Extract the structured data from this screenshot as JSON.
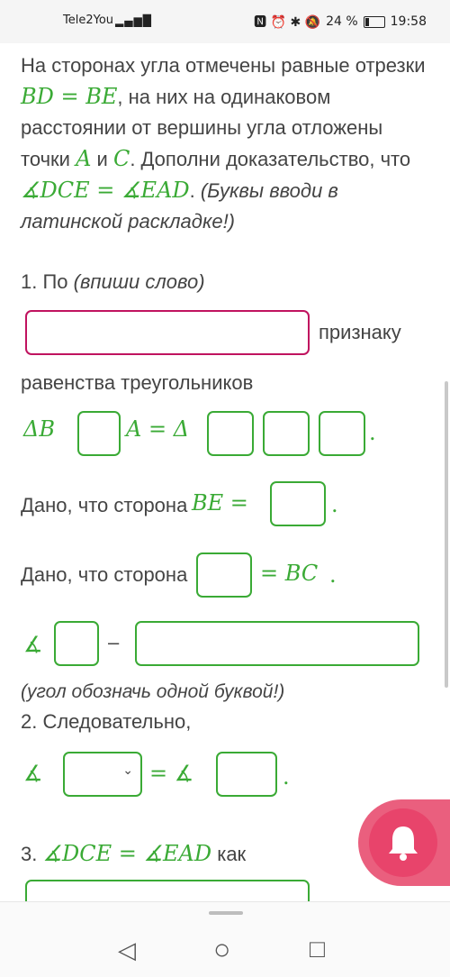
{
  "status_bar": {
    "carrier": "Tele2You",
    "signal": "▂▄▆█",
    "icons": "🅽 ⏰ ✱ 🔕",
    "battery": "24 %",
    "time": "19:58"
  },
  "task": {
    "intro_1": "На сторонах угла отмечены равные отрезки ",
    "eq_1": "BD = BE",
    "intro_2": ", на них на одинаковом расстоянии от вершины угла отложены точки ",
    "point_a": "A",
    "and": " и ",
    "point_c": "C",
    "intro_3": ". Дополни доказательство, что ",
    "angle_eq": "∡DCE = ∡EAD",
    "intro_4": ". ",
    "note": "(Буквы вводи в латинской раскладке!)"
  },
  "step1": {
    "label": "1. По ",
    "hint": "(впиши слово)",
    "after_input": "признаку",
    "line2": "равенства треугольников",
    "tri_left": "ΔB",
    "tri_mid": "A = Δ",
    "tri_dot": ".",
    "given_side_1": "Дано, что сторона ",
    "be_eq": "BE =",
    "dot1": ".",
    "given_side_2": "Дано, что сторона",
    "eq_bc": "= BC",
    "dot2": ".",
    "angle_sym": "∡",
    "dash": "–",
    "angle_hint": "(угол обозначь одной буквой!)"
  },
  "step2": {
    "label": "2. Следовательно,",
    "angle_sym": "∡",
    "eq_angle": "= ∡",
    "dot": "."
  },
  "step3": {
    "label": "3. ",
    "angle_eq": "∡DCE = ∡EAD",
    "as": " как"
  },
  "nav": {
    "back": "◁",
    "home": "○",
    "recents": "□"
  },
  "colors": {
    "accent_green": "#3aaa35",
    "focus_pink": "#c0135f",
    "fab_red": "#e8446b"
  }
}
